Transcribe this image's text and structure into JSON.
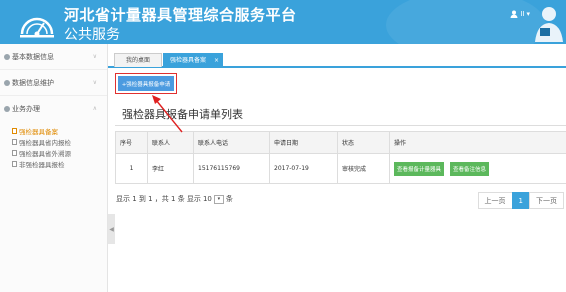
{
  "header": {
    "title": "河北省计量器具管理综合服务平台",
    "subtitle": "公共服务",
    "user_label": "II",
    "brand_color": "#3aa2db"
  },
  "sidebar": {
    "menus": [
      {
        "label": "基本数据信息",
        "icon": "tag-icon"
      },
      {
        "label": "数据信息维护",
        "icon": "tag-icon"
      },
      {
        "label": "业务办理",
        "icon": "tag-icon"
      }
    ],
    "sub_items": [
      {
        "label": "强检器具备案",
        "active": true
      },
      {
        "label": "强检器具省内报检",
        "active": false
      },
      {
        "label": "强检器具省外溯源",
        "active": false
      },
      {
        "label": "非强检器具报检",
        "active": false
      }
    ]
  },
  "tabs": [
    {
      "label": "我的桌面"
    },
    {
      "label": "强检器具备案"
    }
  ],
  "content": {
    "add_button": "+强检器具报备申请",
    "section_title": "强检器具报备申请单列表",
    "columns": [
      "序号",
      "联系人",
      "联系人电话",
      "申请日期",
      "状态",
      "操作"
    ],
    "rows": [
      {
        "index": "1",
        "contact": "李红",
        "phone": "15176115769",
        "date": "2017-07-19",
        "status": "审核完成",
        "actions": [
          "查看报备计量器具",
          "查看备注信息"
        ]
      }
    ]
  },
  "pager": {
    "info_prefix": "显示 1 到 1 ，共 1 条  显示",
    "page_size": "10",
    "info_suffix": "条",
    "prev": "上一页",
    "current": "1",
    "next": "下一页"
  }
}
